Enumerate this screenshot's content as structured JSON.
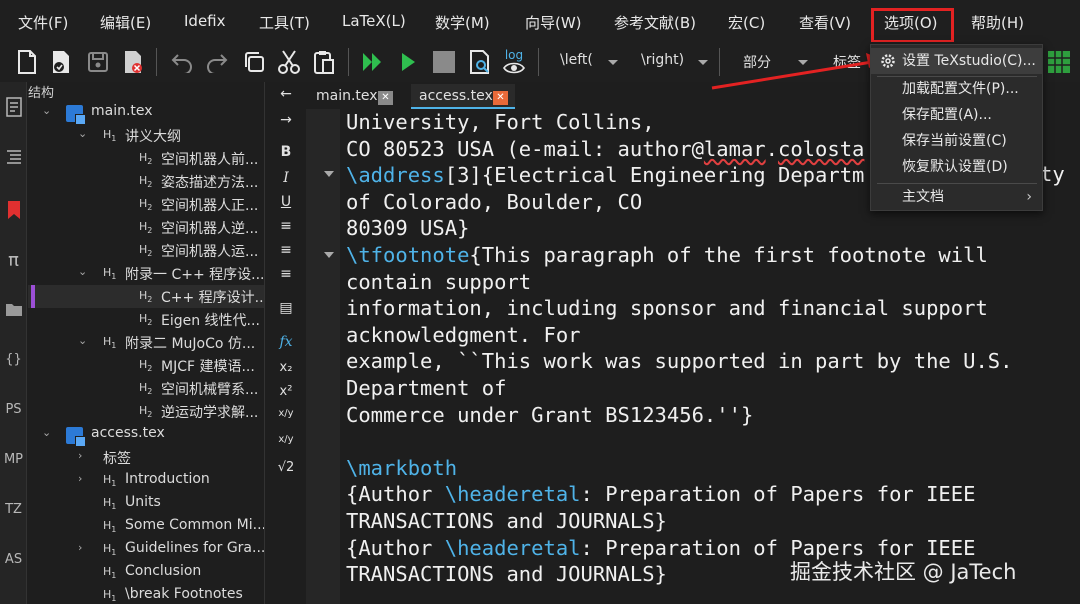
{
  "menubar": {
    "items": [
      "文件(F)",
      "编辑(E)",
      "Idefix",
      "工具(T)",
      "LaTeX(L)",
      "数学(M)",
      "向导(W)",
      "参考文献(B)",
      "宏(C)",
      "查看(V)",
      "选项(O)",
      "帮助(H)"
    ]
  },
  "toolbar": {
    "left_dd": "\\left(",
    "right_dd": "\\right)",
    "part_dd": "部分",
    "label_dd": "标签",
    "log_label": "log"
  },
  "sidebar_icons": [
    "π",
    "{}",
    "PS",
    "MP",
    "TZ",
    "AS"
  ],
  "structure": {
    "title": "结构",
    "rows": [
      {
        "level": 0,
        "type": "file",
        "label": "main.tex",
        "expanded": true
      },
      {
        "level": 1,
        "type": "H1",
        "label": "讲义大纲",
        "expanded": true
      },
      {
        "level": 2,
        "type": "H2",
        "label": "空间机器人前..."
      },
      {
        "level": 2,
        "type": "H2",
        "label": "姿态描述方法..."
      },
      {
        "level": 2,
        "type": "H2",
        "label": "空间机器人正..."
      },
      {
        "level": 2,
        "type": "H2",
        "label": "空间机器人逆..."
      },
      {
        "level": 2,
        "type": "H2",
        "label": "空间机器人运..."
      },
      {
        "level": 1,
        "type": "H1",
        "label": "附录一 C++ 程序设...",
        "expanded": true
      },
      {
        "level": 2,
        "type": "H2",
        "label": "C++ 程序设计...",
        "selected": true
      },
      {
        "level": 2,
        "type": "H2",
        "label": "Eigen 线性代..."
      },
      {
        "level": 1,
        "type": "H1",
        "label": "附录二 MuJoCo 仿...",
        "expanded": true
      },
      {
        "level": 2,
        "type": "H2",
        "label": "MJCF 建模语..."
      },
      {
        "level": 2,
        "type": "H2",
        "label": "空间机械臂系..."
      },
      {
        "level": 2,
        "type": "H2",
        "label": "逆运动学求解..."
      },
      {
        "level": 0,
        "type": "file",
        "label": "access.tex",
        "expanded": true
      },
      {
        "level": 1,
        "type": "group",
        "label": "标签",
        "collapsed": true
      },
      {
        "level": 1,
        "type": "H1",
        "label": "Introduction",
        "collapsed": true
      },
      {
        "level": 1,
        "type": "H1",
        "label": "Units"
      },
      {
        "level": 1,
        "type": "H1",
        "label": "Some Common Mi..."
      },
      {
        "level": 1,
        "type": "H1",
        "label": "Guidelines for Gra...",
        "collapsed": true
      },
      {
        "level": 1,
        "type": "H1",
        "label": "Conclusion"
      },
      {
        "level": 1,
        "type": "H1",
        "label": "\\break Footnotes"
      }
    ]
  },
  "symbols": [
    "←",
    "→",
    "B",
    "I",
    "U",
    "≡",
    "≡",
    "≡",
    "▤",
    "fx",
    "x₂",
    "x²",
    "x/y",
    "x/y",
    "√2"
  ],
  "tabs": [
    {
      "label": "main.tex",
      "active": false
    },
    {
      "label": "access.tex",
      "active": true
    }
  ],
  "editor": {
    "lines": [
      [
        {
          "t": "University, Fort Collins,"
        }
      ],
      [
        {
          "t": "CO 80523 USA (e-mail: author@"
        },
        {
          "t": "lamar",
          "w": true
        },
        {
          "t": "."
        },
        {
          "t": "colosta",
          "w": true
        }
      ],
      [
        {
          "t": "\\address",
          "c": true
        },
        {
          "t": "[3]{Electrical Engineering Departm"
        }
      ],
      [
        {
          "t": "of Colorado, Boulder, CO"
        }
      ],
      [
        {
          "t": "80309 USA}"
        }
      ],
      [
        {
          "t": "\\tfootnote",
          "c": true
        },
        {
          "t": "{This paragraph of the first footnote will"
        }
      ],
      [
        {
          "t": "contain support"
        }
      ],
      [
        {
          "t": "information, including sponsor and financial support"
        }
      ],
      [
        {
          "t": "acknowledgment. For"
        }
      ],
      [
        {
          "t": "example, ``This work was supported in part by the U.S."
        }
      ],
      [
        {
          "t": "Department of"
        }
      ],
      [
        {
          "t": "Commerce under Grant BS123456.''}"
        }
      ],
      [
        {
          "t": ""
        }
      ],
      [
        {
          "t": "\\markboth",
          "c": true
        }
      ],
      [
        {
          "t": "{Author "
        },
        {
          "t": "\\headeretal",
          "c": true
        },
        {
          "t": ": Preparation of Papers for IEEE"
        }
      ],
      [
        {
          "t": "TRANSACTIONS and JOURNALS}"
        }
      ],
      [
        {
          "t": "{Author "
        },
        {
          "t": "\\headeretal",
          "c": true
        },
        {
          "t": ": Preparation of Papers for IEEE"
        }
      ],
      [
        {
          "t": "TRANSACTIONS and JOURNALS}"
        }
      ]
    ],
    "overflow_text": "ty"
  },
  "options_menu": {
    "items": [
      {
        "label": "设置 TeXstudio(C)...",
        "icon": "gear-icon",
        "active": true
      },
      {
        "label": "加载配置文件(P)..."
      },
      {
        "label": "保存配置(A)..."
      },
      {
        "label": "保存当前设置(C)"
      },
      {
        "label": "恢复默认设置(D)"
      },
      {
        "label": "主文档",
        "submenu": true
      }
    ]
  },
  "watermark": "掘金技术社区 @ JaTech",
  "colors": {
    "background": "#1e1e1e",
    "command": "#4fb3e8",
    "annotation_red": "#e32222",
    "file_icon_blue": "#2c7ad6"
  }
}
